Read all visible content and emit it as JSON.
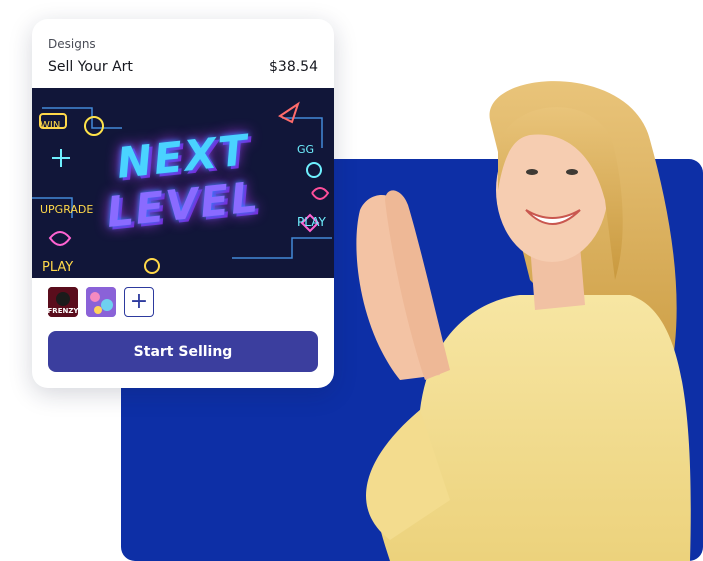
{
  "card": {
    "category": "Designs",
    "title": "Sell Your Art",
    "price": "$38.54",
    "design_headline_line1": "NEXT",
    "design_headline_line2": "LEVEL",
    "thumbnails": [
      {
        "label": "FRENZY"
      },
      {
        "label": ""
      }
    ],
    "start_button_label": "Start Selling"
  },
  "colors": {
    "panel_blue": "#0d2fa6",
    "button_indigo": "#3b3e9e",
    "shirt_yellow": "#f6e08e"
  }
}
